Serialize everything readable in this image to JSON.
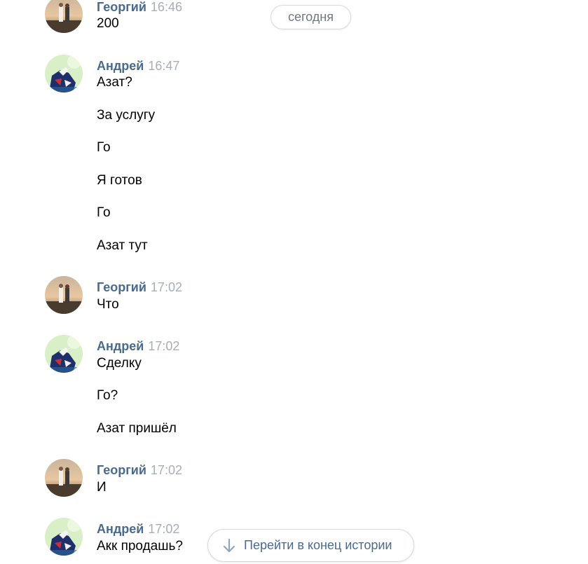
{
  "date_divider": "сегодня",
  "jump_button": {
    "label": "Перейти в конец истории",
    "icon": "arrow-down-icon"
  },
  "colors": {
    "author": "#4a6a8e",
    "time": "#a6aeb8",
    "text": "#000000"
  },
  "messages": [
    {
      "author": "Георгий",
      "time": "16:46",
      "avatar": "georgiy-avatar",
      "lines": [
        "200"
      ]
    },
    {
      "author": "Андрей",
      "time": "16:47",
      "avatar": "andrey-avatar",
      "lines": [
        "Азат?",
        "За услугу",
        "Го",
        "Я готов",
        "Го",
        "Азат тут"
      ]
    },
    {
      "author": "Георгий",
      "time": "17:02",
      "avatar": "georgiy-avatar",
      "lines": [
        "Что"
      ]
    },
    {
      "author": "Андрей",
      "time": "17:02",
      "avatar": "andrey-avatar",
      "lines": [
        "Сделку",
        "Го?",
        "Азат пришёл"
      ]
    },
    {
      "author": "Георгий",
      "time": "17:02",
      "avatar": "georgiy-avatar",
      "lines": [
        "И"
      ]
    },
    {
      "author": "Андрей",
      "time": "17:02",
      "avatar": "andrey-avatar",
      "lines": [
        "Акк продашь?"
      ]
    }
  ]
}
